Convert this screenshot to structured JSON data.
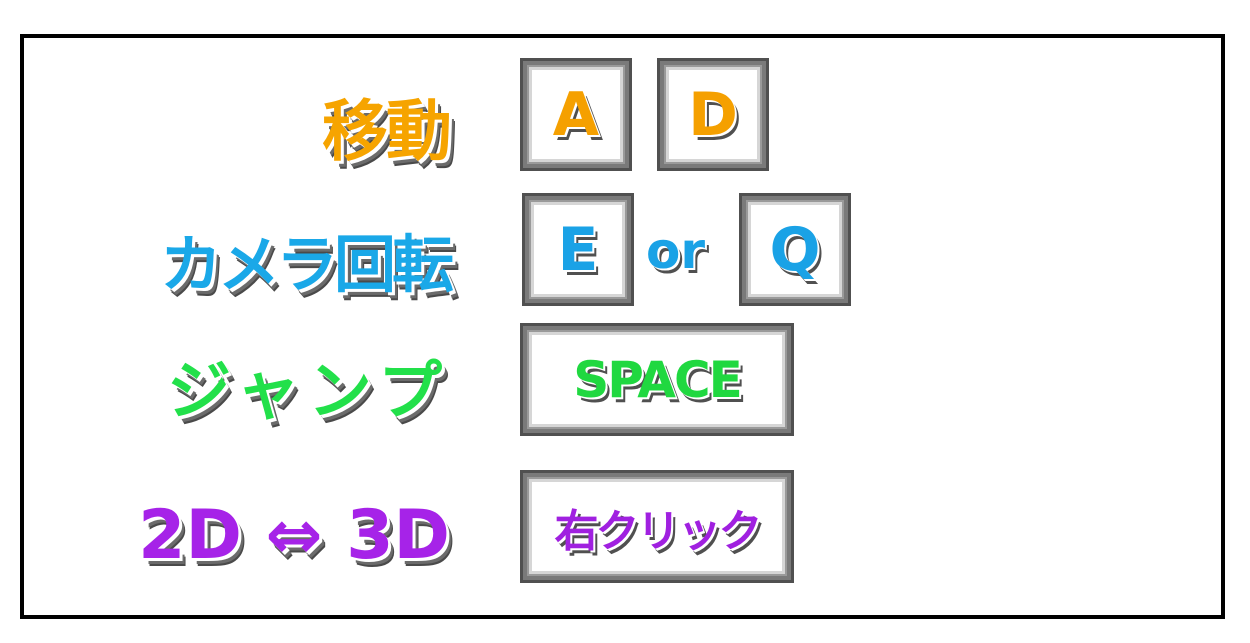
{
  "controls": [
    {
      "action": "移動",
      "keys": [
        "A",
        "D"
      ],
      "color": "#f6a400"
    },
    {
      "action": "カメラ回転",
      "keys": [
        "E",
        "Q"
      ],
      "separator": "or",
      "color": "#1aa8e8"
    },
    {
      "action": "ジャンプ",
      "keys": [
        "SPACE"
      ],
      "color": "#22e04a"
    },
    {
      "action": "2D ⇔ 3D",
      "keys": [
        "右クリック"
      ],
      "color": "#a623e8"
    }
  ]
}
